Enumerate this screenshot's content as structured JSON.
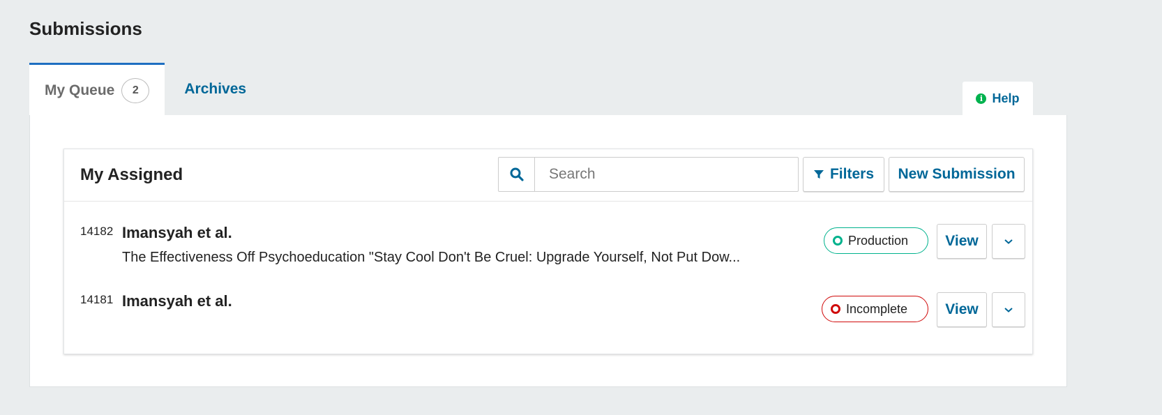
{
  "page": {
    "title": "Submissions"
  },
  "tabs": [
    {
      "label": "My Queue",
      "count": "2"
    },
    {
      "label": "Archives"
    }
  ],
  "help": {
    "label": "Help",
    "icon": "info-icon"
  },
  "list": {
    "title": "My Assigned",
    "search": {
      "placeholder": "Search",
      "value": "",
      "icon": "search-icon"
    },
    "filters_label": "Filters",
    "new_submission_label": "New Submission",
    "items": [
      {
        "id": "14182",
        "author": "Imansyah et al.",
        "title": "The Effectiveness Off Psychoeducation \"Stay Cool Don't Be Cruel: Upgrade Yourself, Not Put Dow...",
        "status": "Production",
        "status_color": "#00b28d",
        "view_label": "View"
      },
      {
        "id": "14181",
        "author": "Imansyah et al.",
        "title": "",
        "status": "Incomplete",
        "status_color": "#d00a0a",
        "view_label": "View"
      }
    ]
  },
  "colors": {
    "link": "#006798",
    "active_tab_border": "#1e6fc1",
    "help_icon": "#00b24e",
    "background": "#eaedee"
  }
}
